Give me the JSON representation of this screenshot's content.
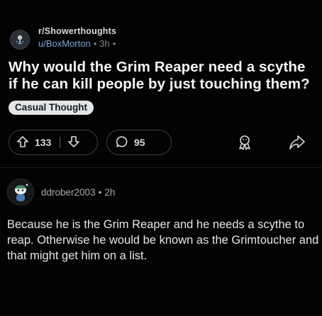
{
  "post": {
    "subreddit": "r/Showerthoughts",
    "author": "u/BoxMorton",
    "separator": "•",
    "time": "3h",
    "trailing_dot": "•",
    "title": "Why would the Grim Reaper need a scythe if he can kill people by just touching them?",
    "flair": "Casual Thought",
    "upvotes": "133",
    "comments": "95"
  },
  "comment": {
    "author": "ddrober2003",
    "separator": "•",
    "time": "2h",
    "body": "Because he is the Grim Reaper and he needs a scythe to reap. Otherwise he would be known as the Grimtoucher and that might get him on a list."
  },
  "icons": {
    "subreddit_avatar": "shower-icon",
    "upvote": "arrow-up-icon",
    "downvote": "arrow-down-icon",
    "comment": "comment-bubble-icon",
    "award": "award-icon",
    "share": "share-icon",
    "comment_avatar": "snoo-avatar-icon"
  },
  "colors": {
    "background": "#030303",
    "author_link": "#7fa7d8",
    "flair_bg": "#e3e6e8"
  }
}
